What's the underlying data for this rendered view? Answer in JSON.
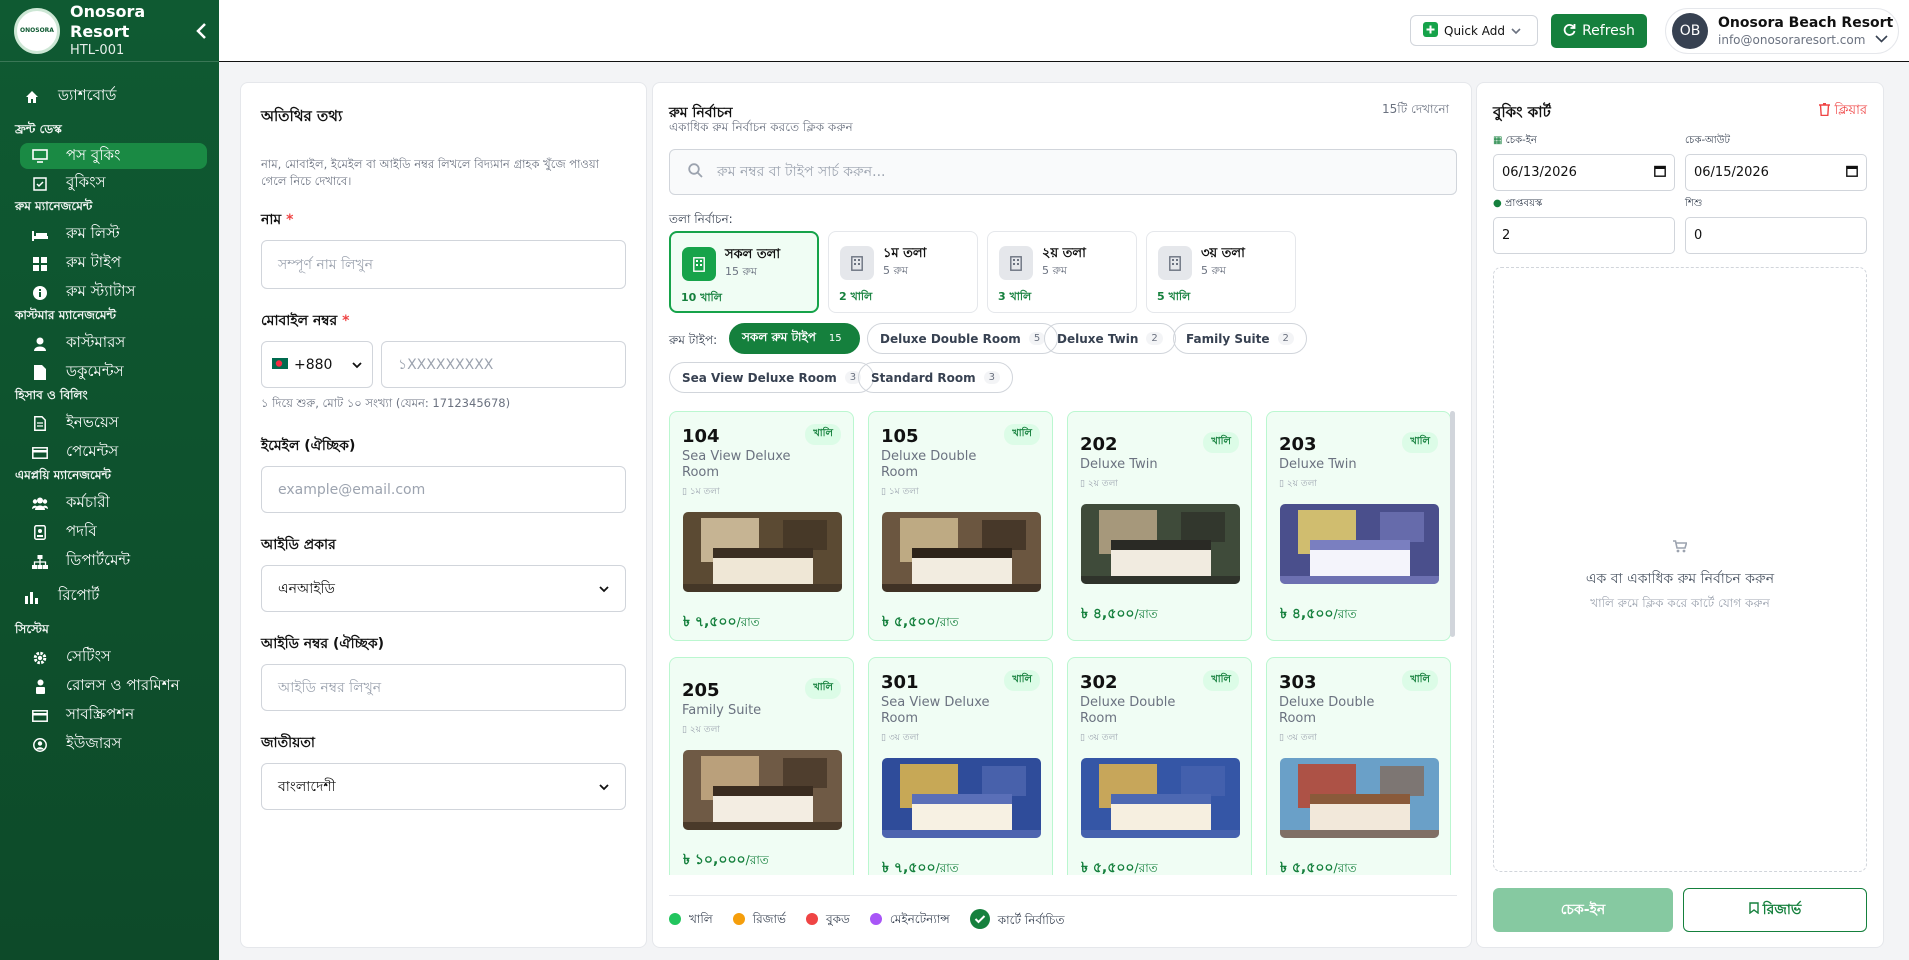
{
  "brand": {
    "name": "Onosora Resort",
    "code": "HTL-001",
    "logo_text": "ONOSORA"
  },
  "sidebar": {
    "dashboard": "ড্যাশবোর্ড",
    "sections": [
      {
        "title": "ফ্রন্ট ডেস্ক",
        "items": [
          "পস বুকিং",
          "বুকিংস"
        ]
      },
      {
        "title": "রুম ম্যানেজমেন্ট",
        "items": [
          "রুম লিস্ট",
          "রুম টাইপ",
          "রুম স্ট্যাটাস"
        ]
      },
      {
        "title": "কাস্টমার ম্যানেজমেন্ট",
        "items": [
          "কাস্টমারস",
          "ডকুমেন্টস"
        ]
      },
      {
        "title": "হিসাব ও বিলিং",
        "items": [
          "ইনভয়েস",
          "পেমেন্টস"
        ]
      },
      {
        "title": "এমপ্লয়ি ম্যানেজমেন্ট",
        "items": [
          "কর্মচারী",
          "পদবি",
          "ডিপার্টমেন্ট"
        ]
      },
      {
        "title": "রিপোর্ট",
        "items": []
      },
      {
        "title": "সিস্টেম",
        "items": [
          "সেটিংস",
          "রোলস ও পারমিশন",
          "সাবস্ক্রিপশন",
          "ইউজারস"
        ]
      }
    ]
  },
  "topbar": {
    "quick_add": "Quick Add",
    "refresh": "Refresh",
    "user_initials": "OB",
    "user_name": "Onosora Beach Resort",
    "user_email": "info@onosoraresort.com"
  },
  "guest": {
    "title": "অতিথির তথ্য",
    "hint": "নাম, মোবাইল, ইমেইল বা আইডি নম্বর লিখলে বিদ্যমান গ্রাহক খুঁজে পাওয়া গেলে নিচে দেখাবে।",
    "name_label": "নাম",
    "name_placeholder": "সম্পূর্ণ নাম লিখুন",
    "mobile_label": "মোবাইল নম্বর",
    "country_code": "+880",
    "mobile_placeholder": "১XXXXXXXXX",
    "mobile_hint": "১ দিয়ে শুরু, মোট ১০ সংখ্যা (যেমন: 1712345678)",
    "email_label": "ইমেইল (ঐচ্ছিক)",
    "email_placeholder": "example@email.com",
    "id_type_label": "আইডি প্রকার",
    "id_type_value": "এনআইডি",
    "id_number_label": "আইডি নম্বর (ঐচ্ছিক)",
    "id_number_placeholder": "আইডি নম্বর লিখুন",
    "nationality_label": "জাতীয়তা",
    "nationality_value": "বাংলাদেশী",
    "required_mark": "*"
  },
  "rooms": {
    "title": "রুম নির্বাচন",
    "subtitle": "একাধিক রুম নির্বাচন করতে ক্লিক করুন",
    "showing": "15টি দেখানো",
    "search_placeholder": "রুম নম্বর বা টাইপ সার্চ করুন...",
    "floor_label": "তলা নির্বাচন:",
    "floors": [
      {
        "name": "সকল তলা",
        "count": "15 রুম",
        "free": "10 খালি"
      },
      {
        "name": "১ম তলা",
        "count": "5 রুম",
        "free": "2 খালি"
      },
      {
        "name": "২য় তলা",
        "count": "5 রুম",
        "free": "3 খালি"
      },
      {
        "name": "৩য় তলা",
        "count": "5 রুম",
        "free": "5 খালি"
      }
    ],
    "type_label": "রুম টাইপ:",
    "types": [
      {
        "name": "সকল রুম টাইপ",
        "count": "15"
      },
      {
        "name": "Deluxe Double Room",
        "count": "5"
      },
      {
        "name": "Deluxe Twin",
        "count": "2"
      },
      {
        "name": "Family Suite",
        "count": "2"
      },
      {
        "name": "Sea View Deluxe Room",
        "count": "3"
      },
      {
        "name": "Standard Room",
        "count": "3"
      }
    ],
    "status_free": "খালি",
    "cards": [
      {
        "num": "104",
        "type": "Sea View Deluxe Room",
        "floor": "১ম তলা",
        "price": "৳ ৭,৫০০",
        "per": "/রাত"
      },
      {
        "num": "105",
        "type": "Deluxe Double Room",
        "floor": "১ম তলা",
        "price": "৳ ৫,৫০০",
        "per": "/রাত"
      },
      {
        "num": "202",
        "type": "Deluxe Twin",
        "floor": "২য় তলা",
        "price": "৳ ৪,৫০০",
        "per": "/রাত"
      },
      {
        "num": "203",
        "type": "Deluxe Twin",
        "floor": "২য় তলা",
        "price": "৳ ৪,৫০০",
        "per": "/রাত"
      },
      {
        "num": "205",
        "type": "Family Suite",
        "floor": "২য় তলা",
        "price": "৳ ১০,০০০",
        "per": "/রাত"
      },
      {
        "num": "301",
        "type": "Sea View Deluxe Room",
        "floor": "৩য় তলা",
        "price": "৳ ৭,৫০০",
        "per": "/রাত"
      },
      {
        "num": "302",
        "type": "Deluxe Double Room",
        "floor": "৩য় তলা",
        "price": "৳ ৫,৫০০",
        "per": "/রাত"
      },
      {
        "num": "303",
        "type": "Deluxe Double Room",
        "floor": "৩য় তলা",
        "price": "৳ ৫,৫০০",
        "per": "/রাত"
      }
    ],
    "legend": [
      "খালি",
      "রিজার্ভ",
      "বুকড",
      "মেইনটেন্যান্স",
      "কার্টে নির্বাচিত"
    ],
    "legend_colors": [
      "#22c55e",
      "#f59e0b",
      "#ef4444",
      "#a855f7",
      "#15803d"
    ]
  },
  "cart": {
    "title": "বুকিং কার্ট",
    "clear": "ক্লিয়ার",
    "checkin_label": "চেক-ইন",
    "checkin_value": "06/13/2026",
    "checkout_label": "চেক-আউট",
    "checkout_value": "06/15/2026",
    "adults_label": "প্রাপ্তবয়স্ক",
    "adults_value": "2",
    "children_label": "শিশু",
    "children_value": "0",
    "empty_title": "এক বা একাধিক রুম নির্বাচন করুন",
    "empty_sub": "খালি রুমে ক্লিক করে কার্টে যোগ করুন",
    "checkin_button": "চেক-ইন",
    "reserve_button": "রিজার্ভ"
  }
}
